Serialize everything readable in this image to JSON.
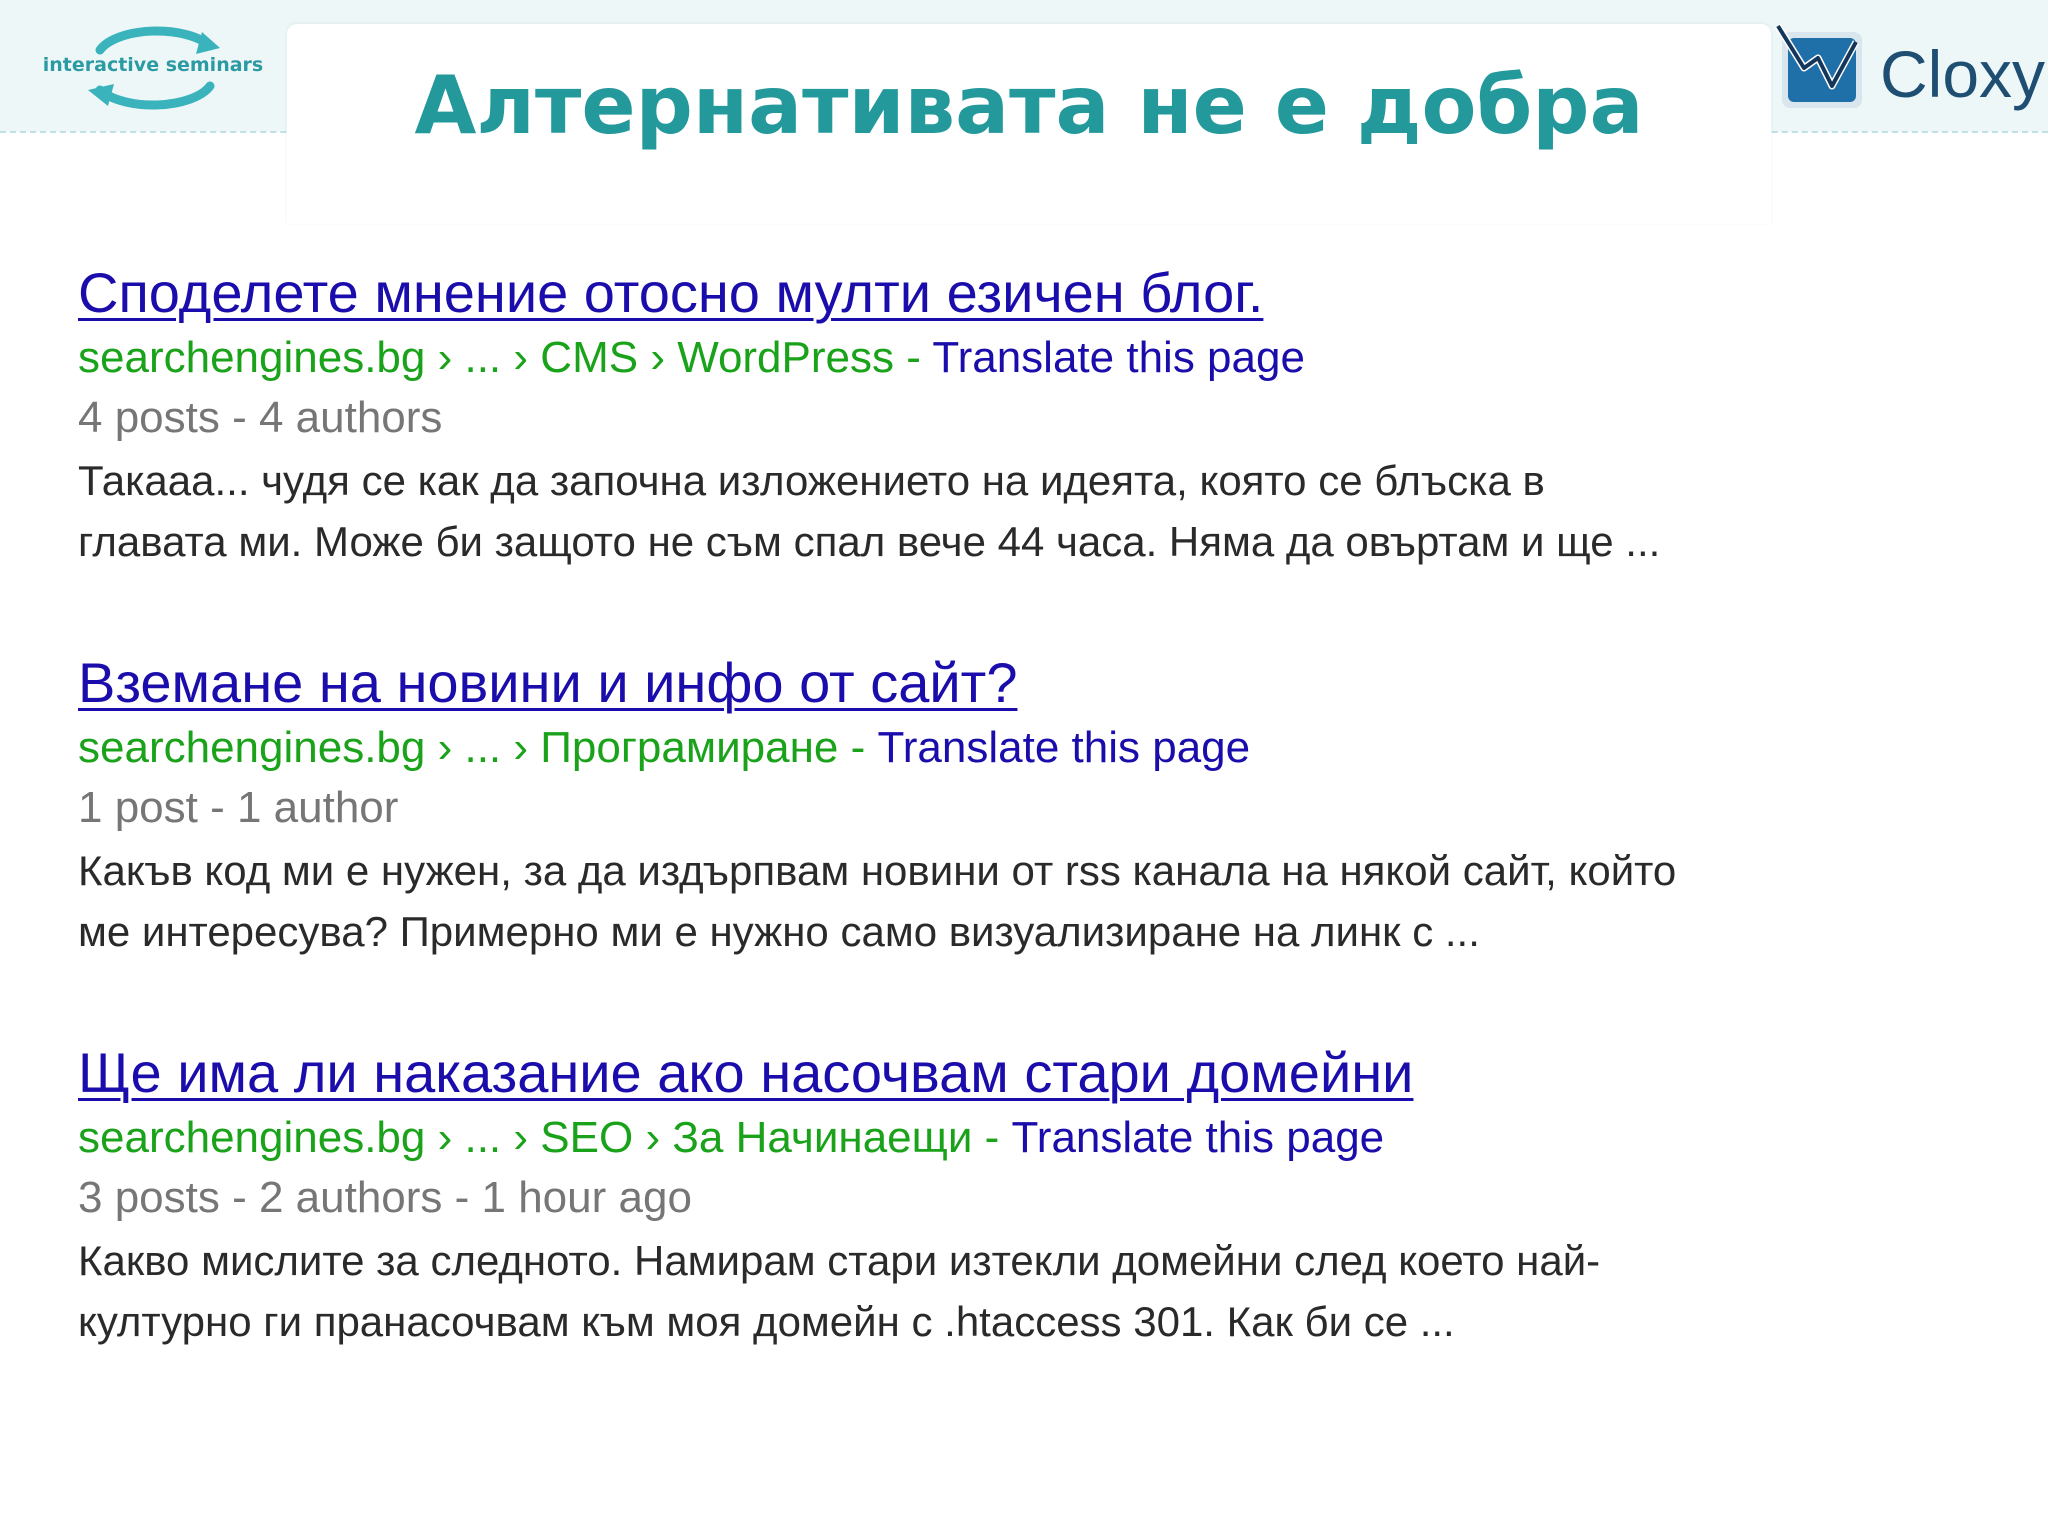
{
  "slide": {
    "title": "Алтернативата не е добра",
    "logo_left_text": "interactive seminars",
    "logo_right_text": "Cloxy",
    "colors": {
      "title": "#23999b",
      "link": "#1a0dab",
      "url": "#1aa31a",
      "meta": "#767676"
    }
  },
  "results": [
    {
      "title": "Споделете мнение отосно мулти езичен блог.",
      "breadcrumb": [
        "searchengines.bg",
        "...",
        "CMS",
        "WordPress"
      ],
      "translate": "Translate this page",
      "meta": "4 posts - 4 authors",
      "snippet_line1": "Такааа... чудя се как да започна изложението на идеята, която се блъска в",
      "snippet_line2": "главата ми. Може би защото не съм спал вече 44 часа. Няма да овъртам и ще ..."
    },
    {
      "title": "Вземане на новини и инфо от сайт?",
      "breadcrumb": [
        "searchengines.bg",
        "...",
        "Програмиране"
      ],
      "translate": "Translate this page",
      "meta": "1 post - 1 author",
      "snippet_line1": "Какъв код ми е нужен, за да издърпвам новини от rss канала на някой сайт, който",
      "snippet_line2": "ме интересува? Примерно ми е нужно само визуализиране на линк с ..."
    },
    {
      "title": "Ще има ли наказание ако насочвам стари домейни",
      "breadcrumb": [
        "searchengines.bg",
        "...",
        "SEO",
        "За Начинаещи"
      ],
      "translate": "Translate this page",
      "meta": "3 posts - 2 authors - 1 hour ago",
      "snippet_line1": "Какво мислите за следното. Намирам стари изтекли домейни след което най-",
      "snippet_line2": "културно ги пранасочвам към моя домейн с .htaccess 301. Как би се ..."
    }
  ]
}
